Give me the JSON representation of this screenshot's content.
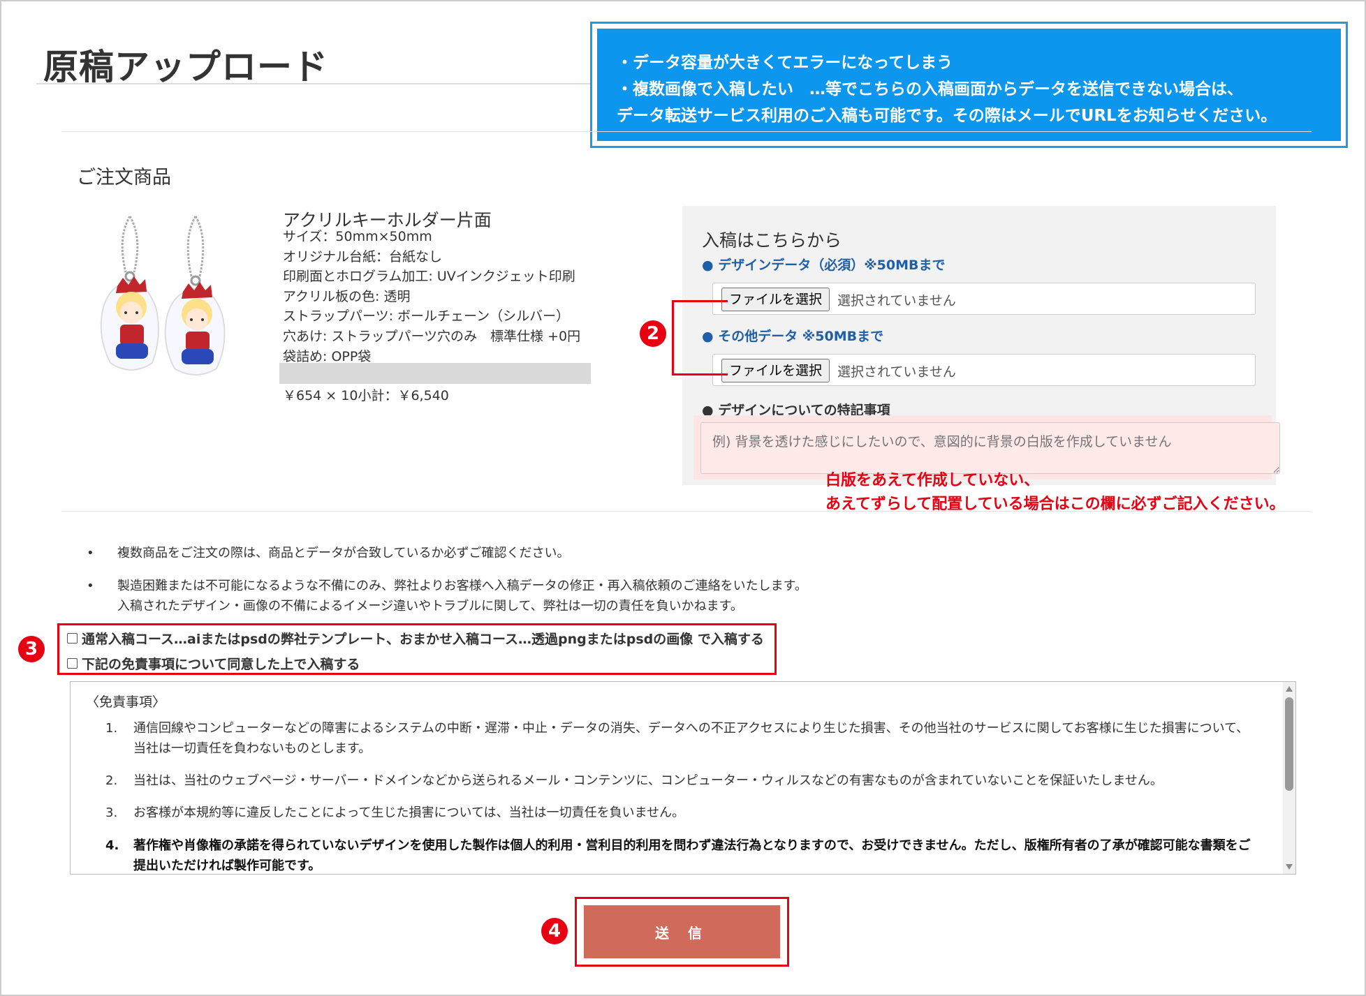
{
  "page": {
    "title": "原稿アップロード"
  },
  "info_box": {
    "lines": [
      "・データ容量が大きくてエラーになってしまう",
      "・複数画像で入稿したい　…等でこちらの入稿画面からデータを送信できない場合は、",
      "データ転送サービス利用のご入稿も可能です。その際はメールでURLをお知らせください。"
    ]
  },
  "order": {
    "heading": "ご注文商品",
    "product_name": "アクリルキーホルダー片面",
    "specs": [
      "サイズ：50mm×50mm",
      "オリジナル台紙：台紙なし",
      "印刷面とホログラム加工: UVインクジェット印刷",
      "アクリル板の色: 透明",
      "ストラップパーツ: ボールチェーン（シルバー）",
      "穴あけ: ストラップパーツ穴のみ　標準仕様 +0円",
      "袋詰め: OPP袋"
    ],
    "price_line": "￥654 × 10小計：￥6,540"
  },
  "upload": {
    "title": "入稿はこちらから",
    "design_label": "● デザインデータ（必須）※50MBまで",
    "other_label": "● その他データ ※50MBまで",
    "notes_label": "● デザインについての特記事項",
    "file_button_label": "ファイルを選択",
    "file_status": "選択されていません",
    "notes_placeholder": "例) 背景を透けた感じにしたいので、意図的に背景の白版を作成していません"
  },
  "annotations": {
    "red_note_1": "白版をあえて作成していない、",
    "red_note_2": "あえてずらして配置している場合はこの欄に必ずご記入ください。",
    "badge_2": "2",
    "badge_3": "3",
    "badge_4": "4",
    "accent_color": "#e60012"
  },
  "notices": [
    {
      "bullet": "•",
      "lines": [
        "複数商品をご注文の際は、商品とデータが合致しているか必ずご確認ください。"
      ]
    },
    {
      "bullet": "•",
      "lines": [
        "製造困難または不可能になるような不備にのみ、弊社よりお客様へ入稿データの修正・再入稿依頼のご連絡をいたします。",
        "入稿されたデザイン・画像の不備によるイメージ違いやトラブルに関して、弊社は一切の責任を負いかねます。"
      ]
    }
  ],
  "checkboxes": {
    "course": "通常入稿コース…aiまたはpsdの弊社テンプレート、おまかせ入稿コース…透過pngまたはpsdの画像 で入稿する",
    "agree": "下記の免責事項について同意した上で入稿する"
  },
  "disclaimer": {
    "heading": "〈免責事項〉",
    "items": [
      {
        "num": "1.",
        "text": "通信回線やコンピューターなどの障害によるシステムの中断・遅滞・中止・データの消失、データへの不正アクセスにより生じた損害、その他当社のサービスに関してお客様に生じた損害について、当社は一切責任を負わないものとします。"
      },
      {
        "num": "2.",
        "text": "当社は、当社のウェブページ・サーバー・ドメインなどから送られるメール・コンテンツに、コンピューター・ウィルスなどの有害なものが含まれていないことを保証いたしません。"
      },
      {
        "num": "3.",
        "text": "お客様が本規約等に違反したことによって生じた損害については、当社は一切責任を負いません。"
      },
      {
        "num": "4.",
        "text": "著作権や肖像権の承諾を得られていないデザインを使用した製作は個人的利用・営利目的利用を問わず違法行為となりますので、お受けできません。ただし、版権所有者の了承が確認可能な書類をご提出いただければ製作可能です。"
      }
    ]
  },
  "submit": {
    "label": "送 信",
    "color": "#d06a5a"
  }
}
